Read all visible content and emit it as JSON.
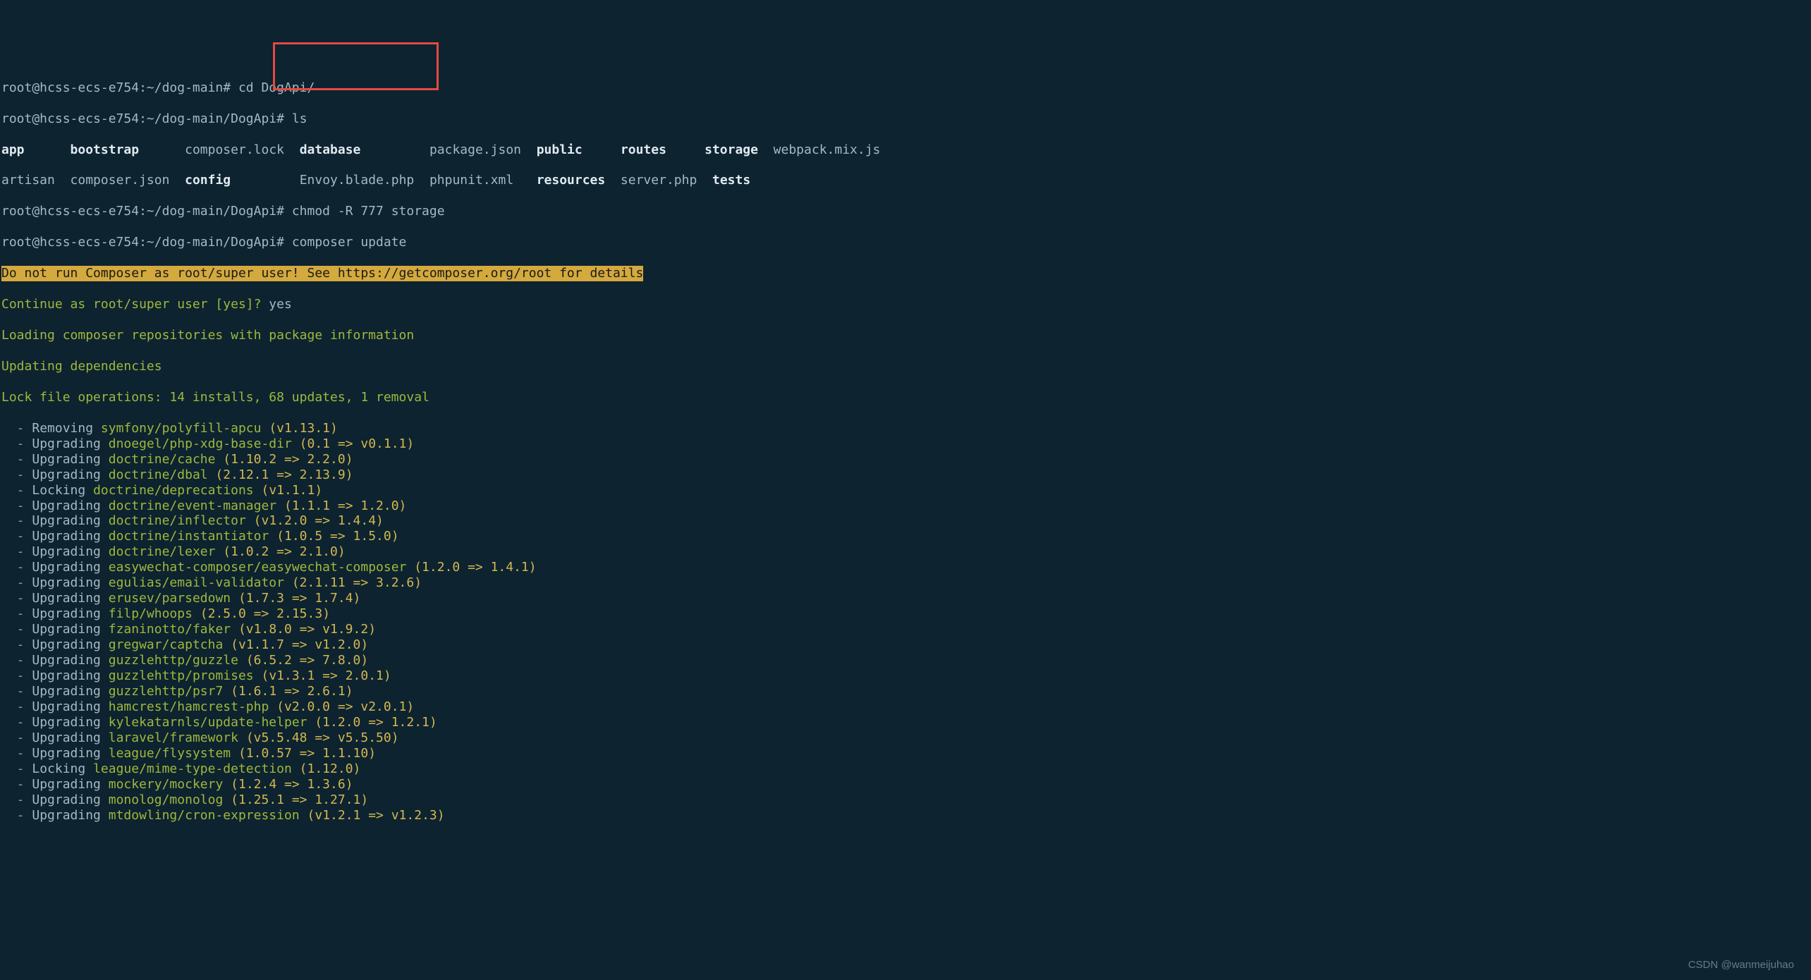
{
  "prompts": {
    "p1": "root@hcss-ecs-e754:~/dog-main# ",
    "p2": "root@hcss-ecs-e754:~/dog-main/DogApi# "
  },
  "cmds": {
    "cd": "cd DogApi/",
    "ls": "ls",
    "chmod": "chmod -R 777 storage",
    "composer": "composer update"
  },
  "ls_output": {
    "row1": {
      "c1": "app",
      "c2": "bootstrap",
      "c3": "composer.lock",
      "c4": "database",
      "c5": "package.json",
      "c6": "public",
      "c7": "routes",
      "c8": "storage",
      "c9": "webpack.mix.js"
    },
    "row2": {
      "c1": "artisan",
      "c2": "composer.json",
      "c3": "config",
      "c4": "Envoy.blade.php",
      "c5": "phpunit.xml",
      "c6": "resources",
      "c7": "server.php",
      "c8": "tests",
      "c9": ""
    }
  },
  "warning": "Do not run Composer as root/super user! See https://getcomposer.org/root for details",
  "lines": {
    "continue_q": "Continue as root/super user [yes]? ",
    "continue_a": "yes",
    "loading": "Loading composer repositories with package information",
    "updating": "Updating dependencies",
    "lockfile": "Lock file operations: 14 installs, 68 updates, 1 removal"
  },
  "ops": [
    {
      "action": "Removing",
      "pkg": "symfony/polyfill-apcu",
      "ver": "(v1.13.1)"
    },
    {
      "action": "Upgrading",
      "pkg": "dnoegel/php-xdg-base-dir",
      "ver": "(0.1 => v0.1.1)"
    },
    {
      "action": "Upgrading",
      "pkg": "doctrine/cache",
      "ver": "(1.10.2 => 2.2.0)"
    },
    {
      "action": "Upgrading",
      "pkg": "doctrine/dbal",
      "ver": "(2.12.1 => 2.13.9)"
    },
    {
      "action": "Locking",
      "pkg": "doctrine/deprecations",
      "ver": "(v1.1.1)"
    },
    {
      "action": "Upgrading",
      "pkg": "doctrine/event-manager",
      "ver": "(1.1.1 => 1.2.0)"
    },
    {
      "action": "Upgrading",
      "pkg": "doctrine/inflector",
      "ver": "(v1.2.0 => 1.4.4)"
    },
    {
      "action": "Upgrading",
      "pkg": "doctrine/instantiator",
      "ver": "(1.0.5 => 1.5.0)"
    },
    {
      "action": "Upgrading",
      "pkg": "doctrine/lexer",
      "ver": "(1.0.2 => 2.1.0)"
    },
    {
      "action": "Upgrading",
      "pkg": "easywechat-composer/easywechat-composer",
      "ver": "(1.2.0 => 1.4.1)"
    },
    {
      "action": "Upgrading",
      "pkg": "egulias/email-validator",
      "ver": "(2.1.11 => 3.2.6)"
    },
    {
      "action": "Upgrading",
      "pkg": "erusev/parsedown",
      "ver": "(1.7.3 => 1.7.4)"
    },
    {
      "action": "Upgrading",
      "pkg": "filp/whoops",
      "ver": "(2.5.0 => 2.15.3)"
    },
    {
      "action": "Upgrading",
      "pkg": "fzaninotto/faker",
      "ver": "(v1.8.0 => v1.9.2)"
    },
    {
      "action": "Upgrading",
      "pkg": "gregwar/captcha",
      "ver": "(v1.1.7 => v1.2.0)"
    },
    {
      "action": "Upgrading",
      "pkg": "guzzlehttp/guzzle",
      "ver": "(6.5.2 => 7.8.0)"
    },
    {
      "action": "Upgrading",
      "pkg": "guzzlehttp/promises",
      "ver": "(v1.3.1 => 2.0.1)"
    },
    {
      "action": "Upgrading",
      "pkg": "guzzlehttp/psr7",
      "ver": "(1.6.1 => 2.6.1)"
    },
    {
      "action": "Upgrading",
      "pkg": "hamcrest/hamcrest-php",
      "ver": "(v2.0.0 => v2.0.1)"
    },
    {
      "action": "Upgrading",
      "pkg": "kylekatarnls/update-helper",
      "ver": "(1.2.0 => 1.2.1)"
    },
    {
      "action": "Upgrading",
      "pkg": "laravel/framework",
      "ver": "(v5.5.48 => v5.5.50)"
    },
    {
      "action": "Upgrading",
      "pkg": "league/flysystem",
      "ver": "(1.0.57 => 1.1.10)"
    },
    {
      "action": "Locking",
      "pkg": "league/mime-type-detection",
      "ver": "(1.12.0)"
    },
    {
      "action": "Upgrading",
      "pkg": "mockery/mockery",
      "ver": "(1.2.4 => 1.3.6)"
    },
    {
      "action": "Upgrading",
      "pkg": "monolog/monolog",
      "ver": "(1.25.1 => 1.27.1)"
    },
    {
      "action": "Upgrading",
      "pkg": "mtdowling/cron-expression",
      "ver": "(v1.2.1 => v1.2.3)"
    }
  ],
  "watermark": "CSDN @wanmeijuhao"
}
